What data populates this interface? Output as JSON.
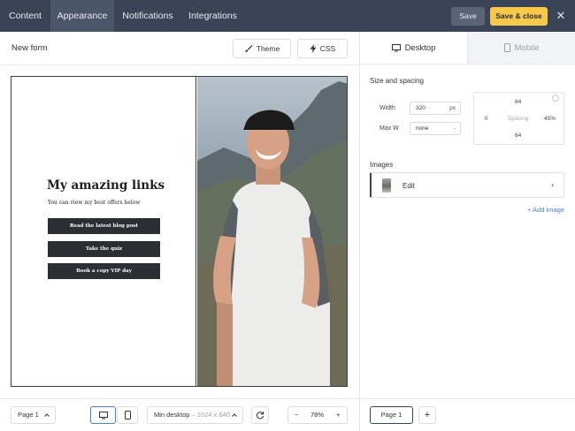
{
  "nav": {
    "tabs": [
      {
        "label": "Content"
      },
      {
        "label": "Appearance"
      },
      {
        "label": "Notifications"
      },
      {
        "label": "Integrations"
      }
    ],
    "save_label": "Save",
    "save_close_label": "Save & close",
    "close_glyph": "✕"
  },
  "header": {
    "form_name": "New form",
    "theme_label": "Theme",
    "css_label": "CSS"
  },
  "canvas": {
    "headline": "My amazing links",
    "subline": "You can view my best offers below",
    "buttons": [
      {
        "label": "Read the latest blog post"
      },
      {
        "label": "Take the quiz"
      },
      {
        "label": "Book a copy VIP day"
      }
    ]
  },
  "panel": {
    "tab_desktop": "Desktop",
    "tab_mobile": "Mobile",
    "size_section": "Size and spacing",
    "width_label": "Width",
    "width_value": "320",
    "width_unit": "px",
    "maxw_label": "Max W",
    "maxw_value": "none",
    "spacing": {
      "top": "64",
      "left": "0",
      "label": "Spacing",
      "right": "45%",
      "bottom": "64"
    },
    "images_section": "Images",
    "image_edit_label": "Edit",
    "add_image": "+ Add image"
  },
  "bottom": {
    "page_select": "Page 1",
    "min_desktop_label": "Min desktop",
    "min_desktop_size": "– 1024 x 640",
    "zoom": "78%",
    "minus": "−",
    "plus": "+",
    "page_tab": "Page 1",
    "add_page": "+"
  },
  "icons": [
    "brush-icon",
    "bolt-icon",
    "monitor-icon",
    "phone-icon",
    "chevron-up-icon",
    "refresh-icon",
    "chevron-right-icon",
    "close-icon",
    "info-icon"
  ]
}
